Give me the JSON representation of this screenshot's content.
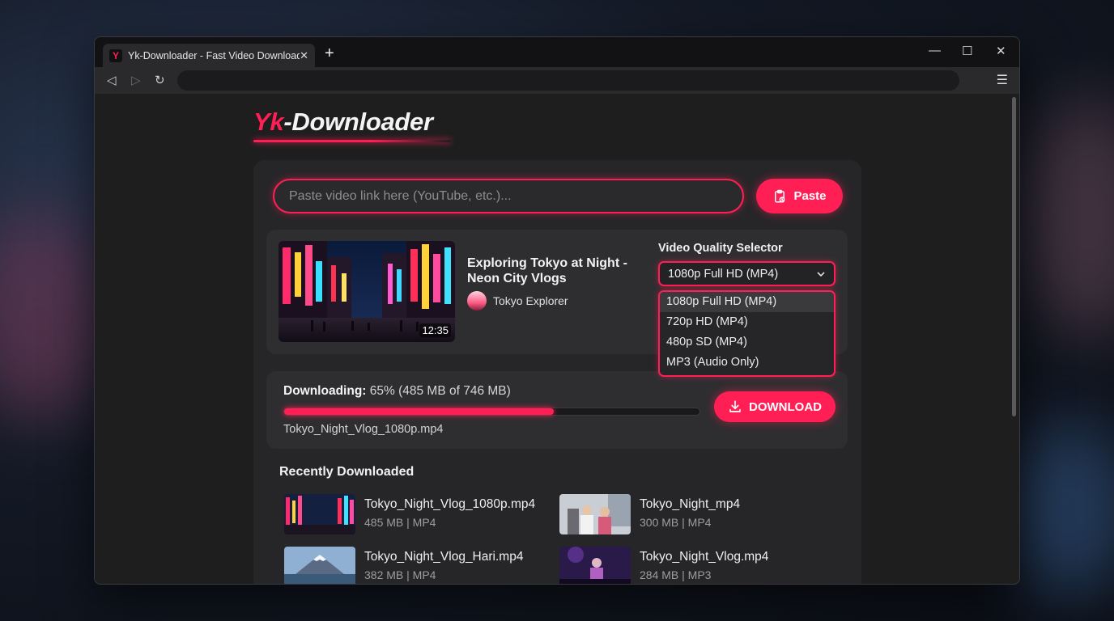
{
  "browser": {
    "tab_title": "Yk-Downloader - Fast Video Downloader",
    "tab_logo_letter": "Y",
    "tab_close": "✕",
    "new_tab": "+",
    "controls": {
      "minimize": "—",
      "maximize": "☐",
      "close": "✕"
    },
    "nav": {
      "back": "◁",
      "forward": "▷",
      "reload": "↻",
      "menu": "☰"
    }
  },
  "brand": {
    "prefix": "Yk",
    "suffix": "-Downloader"
  },
  "search": {
    "placeholder": "Paste video link here (YouTube, etc.)...",
    "paste_label": "Paste"
  },
  "video": {
    "title": "Exploring Tokyo at Night - Neon City Vlogs",
    "channel": "Tokyo Explorer",
    "duration": "12:35"
  },
  "quality": {
    "label": "Video Quality Selector",
    "selected": "1080p Full HD (MP4)",
    "options": [
      "1080p Full HD (MP4)",
      "720p HD (MP4)",
      "480p SD (MP4)",
      "MP3 (Audio Only)"
    ]
  },
  "download": {
    "status_label": "Downloading:",
    "status_detail": "65% (485 MB of 746 MB)",
    "progress_percent": 65,
    "file_name": "Tokyo_Night_Vlog_1080p.mp4",
    "button_label": "DOWNLOAD"
  },
  "recent": {
    "title": "Recently Downloaded",
    "items": [
      {
        "name": "Tokyo_Night_Vlog_1080p.mp4",
        "meta": "485 MB | MP4"
      },
      {
        "name": "Tokyo_Night_mp4",
        "meta": "300 MB | MP4"
      },
      {
        "name": "Tokyo_Night_Vlog_Hari.mp4",
        "meta": "382 MB | MP4"
      },
      {
        "name": "Tokyo_Night_Vlog.mp4",
        "meta": "284 MB | MP3"
      }
    ]
  },
  "colors": {
    "accent": "#ff1f55",
    "panel": "#262628",
    "card": "#2e2e30"
  }
}
